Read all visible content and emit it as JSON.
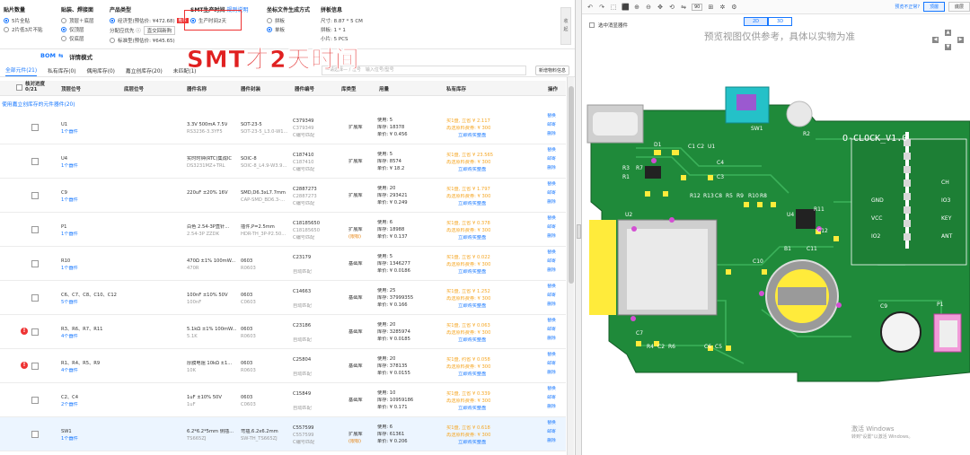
{
  "options": {
    "qty": {
      "title": "贴片数量",
      "items": [
        "5片全贴",
        "2片低3片不贴"
      ],
      "selected": 0
    },
    "side": {
      "title": "贴装、焊接面",
      "items": [
        "顶层＋底层",
        "仅顶层",
        "仅底层"
      ],
      "selected": 1
    },
    "product": {
      "title": "产品类型",
      "items": [
        "经济型(预估价: ¥472.68)",
        "分配应优先 ⓘ",
        "标准型(预估价: ¥645.65)"
      ],
      "badge": "推荐",
      "select_value": "直交回新购",
      "selected": 0
    },
    "smt_time": {
      "title": "SMT生产时间",
      "link": "规则说明",
      "items": [
        "生产时间2天"
      ],
      "selected": 0
    },
    "pos_file": {
      "title": "坐标文件生成方式",
      "items": [
        "拼板",
        "单板"
      ],
      "selected": 1
    },
    "panel": {
      "title": "拼板信息",
      "lines": [
        "尺寸: 8.87 * 5 CM",
        "拼板: 1 * 1",
        "小片: 5 PCS"
      ]
    },
    "counter_text": [
      "收",
      "起"
    ]
  },
  "banner_text": "SMT才2天时间",
  "bom": {
    "title": "BOM",
    "mode_label": "详情模式"
  },
  "tabs": [
    "全部元件(21)",
    "私有库存(0)",
    "偶用库存(0)",
    "嘉立创库存(20)",
    "未匹配(1)"
  ],
  "search_placeholder": "输入位号/型号",
  "search_prefix": "—请选择— / 位号",
  "new_material_btn": "新增物料信息",
  "headers": {
    "chk": "核对进度 0/21",
    "ref": "顶层位号",
    "bottom_ref": "底层位号",
    "name": "器件名称",
    "pkg": "器件封装",
    "part": "器件编号",
    "lib": "库类型",
    "use": "用量",
    "private": "私有库存",
    "action": "操作"
  },
  "section_label": "使用嘉立创库存的元件器件(20)",
  "rows": [
    {
      "ref": "U1",
      "link": "1个器件",
      "name": "3.3V 500mA 7.5V",
      "name2": "RS3236-3.3YF5",
      "pkg": "SOT-23-5",
      "pkg2": "SOT-23-5_L3.0-W1...",
      "part": "C379349",
      "part2": "C379349",
      "part3": "C编号匹配",
      "lib": "扩展库",
      "lib2": "",
      "use": "使用: 5",
      "stock": "库存: 18378",
      "price": "单价: ¥ 0.456",
      "buy": "买1盘, 立省 ¥ 2.117",
      "buy2": "再送原料费券: ¥ 300",
      "buy3": "立即购买整盘",
      "warn": false,
      "hl": false
    },
    {
      "ref": "U4",
      "link": "1个器件",
      "name": "实时时钟(RTC)集成IC",
      "name2": "DS3231MZ+TRL",
      "pkg": "SOIC-8",
      "pkg2": "SOIC-8_L4.9-W3.9...",
      "part": "C187410",
      "part2": "C187410",
      "part3": "C编号匹配",
      "lib": "扩展库",
      "lib2": "",
      "use": "使用: 5",
      "stock": "库存: 8574",
      "price": "单价: ¥ 18.2",
      "buy": "买1盘, 立省 ¥ 23.565",
      "buy2": "再送原料费券: ¥ 300",
      "buy3": "立即购买整盘",
      "warn": false,
      "hl": false
    },
    {
      "ref": "C9",
      "link": "1个器件",
      "name": "220uF ±20% 16V",
      "name2": "",
      "pkg": "SMD,D6.3xL7.7mm",
      "pkg2": "CAP-SMD_BD6.3-...",
      "part": "C2887273",
      "part2": "C2887273",
      "part3": "C编号匹配",
      "lib": "扩展库",
      "lib2": "",
      "use": "使用: 20",
      "stock": "库存: 293421",
      "price": "单价: ¥ 0.249",
      "buy": "买1盘, 立省 ¥ 1.797",
      "buy2": "再送原料费券: ¥ 300",
      "buy3": "立即购买整盘",
      "warn": false,
      "hl": false
    },
    {
      "ref": "P1",
      "link": "1个器件",
      "name": "白色 2.54-3P直针...",
      "name2": "2.54-3P ZZDK",
      "pkg": "插件,P=2.5mm",
      "pkg2": "HDR-TH_3P-P2.50...",
      "part": "C18185650",
      "part2": "C18185650",
      "part3": "C编号匹配",
      "lib": "扩展库",
      "lib2": "(限标)",
      "use": "使用: 6",
      "stock": "库存: 18988",
      "price": "单价: ¥ 0.137",
      "buy": "买1盘, 立省 ¥ 0.378",
      "buy2": "再送原料费券: ¥ 300",
      "buy3": "立即购买整盘",
      "warn": false,
      "hl": false
    },
    {
      "ref": "R10",
      "link": "1个器件",
      "name": "470Ω ±1% 100mW...",
      "name2": "470R",
      "pkg": "0603",
      "pkg2": "R0603",
      "part": "C23179",
      "part2": "",
      "part3": "自动匹配",
      "lib": "基础库",
      "lib2": "",
      "use": "使用: 5",
      "stock": "库存: 1346277",
      "price": "单价: ¥ 0.0186",
      "buy": "买1盘, 立省 ¥ 0.022",
      "buy2": "再送原料费券: ¥ 300",
      "buy3": "立即购买整盘",
      "warn": false,
      "hl": false
    },
    {
      "ref": "C6、C7、C8、C10、C12",
      "link": "5个器件",
      "name": "100nF ±10% 50V",
      "name2": "100nF",
      "pkg": "0603",
      "pkg2": "C0603",
      "part": "C14663",
      "part2": "",
      "part3": "自动匹配",
      "lib": "基础库",
      "lib2": "",
      "use": "使用: 25",
      "stock": "库存: 37999355",
      "price": "单价: ¥ 0.166",
      "buy": "买1盘, 立省 ¥ 1.252",
      "buy2": "再送原料费券: ¥ 300",
      "buy3": "立即购买整盘",
      "warn": false,
      "hl": false
    },
    {
      "ref": "R3、R6、R7、R11",
      "link": "4个器件",
      "name": "5.1kΩ ±1% 100mW...",
      "name2": "5.1K",
      "pkg": "0603",
      "pkg2": "R0603",
      "part": "C23186",
      "part2": "",
      "part3": "自动匹配",
      "lib": "基础库",
      "lib2": "",
      "use": "使用: 20",
      "stock": "库存: 3285974",
      "price": "单价: ¥ 0.0185",
      "buy": "买1盘, 立省 ¥ 0.063",
      "buy2": "再送原料费券: ¥ 300",
      "buy3": "立即购买整盘",
      "warn": true,
      "hl": false
    },
    {
      "ref": "R1、R4、R5、R9",
      "link": "4个器件",
      "name": "厚膜电阻 10kΩ ±1...",
      "name2": "10K",
      "pkg": "0603",
      "pkg2": "R0603",
      "part": "C25804",
      "part2": "",
      "part3": "自动匹配",
      "lib": "基础库",
      "lib2": "",
      "use": "使用: 20",
      "stock": "库存: 378135",
      "price": "单价: ¥ 0.0155",
      "buy": "买1盘, 约省 ¥ 0.058",
      "buy2": "再送原料费券: ¥ 300",
      "buy3": "立即购买整盘",
      "warn": true,
      "hl": false
    },
    {
      "ref": "C2、C4",
      "link": "2个器件",
      "name": "1uF ±10% 50V",
      "name2": "1uF",
      "pkg": "0603",
      "pkg2": "C0603",
      "part": "C15849",
      "part2": "",
      "part3": "自动匹配",
      "lib": "基础库",
      "lib2": "",
      "use": "使用: 10",
      "stock": "库存: 10959186",
      "price": "单价: ¥ 0.171",
      "buy": "买1盘, 立省 ¥ 0.339",
      "buy2": "再送原料费券: ¥ 300",
      "buy3": "立即购买整盘",
      "warn": false,
      "hl": false
    },
    {
      "ref": "SW1",
      "link": "1个器件",
      "name": "6.2*6.2*5mm 侧插...",
      "name2": "TS665ZJ",
      "pkg": "弯插,6.2x6.2mm",
      "pkg2": "SW-TH_TS665ZJ",
      "part": "C557599",
      "part2": "C557599",
      "part3": "C编号匹配",
      "lib": "扩展库",
      "lib2": "(限标)",
      "use": "使用: 6",
      "stock": "库存: 61361",
      "price": "单价: ¥ 0.206",
      "buy": "买1盘, 立省 ¥ 0.618",
      "buy2": "再送原料费券: ¥ 300",
      "buy3": "立即购买整盘",
      "warn": false,
      "hl": true
    }
  ],
  "actions": [
    "替换",
    "邮寄",
    "删除"
  ],
  "preview": {
    "toolbar_zoom": "90",
    "link": "预览不正常?",
    "btn_top": "顶層",
    "btn_bottom": "底层",
    "view2d": "2D",
    "view3d": "3D",
    "show_label": "选中消显器件",
    "note": "预览视图仅供参考，具体以实物为准",
    "board_title": "O-CLOCK_V1.0",
    "silk": [
      "USB1",
      "D1",
      "C1",
      "C2",
      "U1",
      "C4",
      "C3",
      "R1",
      "SW1",
      "R2",
      "R3",
      "R7",
      "U2",
      "R12",
      "R13",
      "C8",
      "R5",
      "R9",
      "R10",
      "R8",
      "U4",
      "R11",
      "C12",
      "C10",
      "B1",
      "C11",
      "C9",
      "P1",
      "C7",
      "R4",
      "C2",
      "R6",
      "C6",
      "C5",
      "GND",
      "VCC",
      "IO2",
      "IO3",
      "KEY",
      "ANT",
      "CH"
    ],
    "windows1": "激活 Windows",
    "windows2": "转到\"设置\"以激活 Windows。"
  }
}
